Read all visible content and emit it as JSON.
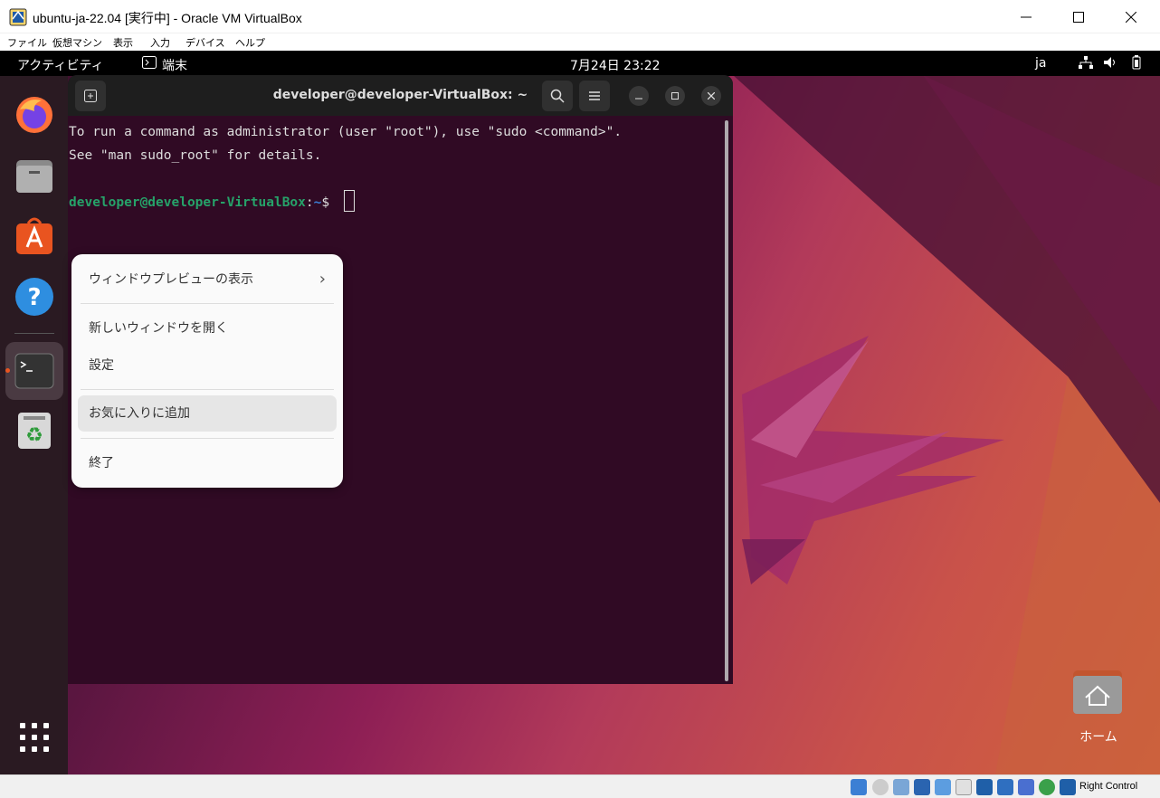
{
  "window": {
    "title": "ubuntu-ja-22.04 [実行中] - Oracle VM VirtualBox",
    "minimize_glyph": "—",
    "maximize_glyph": "☐",
    "close_glyph": "✕"
  },
  "menubar": {
    "items": [
      "ファイル",
      "仮想マシン",
      "表示",
      "入力",
      "デバイス",
      "ヘルプ"
    ]
  },
  "gnome_topbar": {
    "activities": "アクティビティ",
    "app_name": "端末",
    "clock": "7月24日  23:22",
    "input_method": "ja"
  },
  "terminal": {
    "title": "developer@developer-VirtualBox: ~",
    "lines": [
      "To run a command as administrator (user \"root\"), use \"sudo <command>\".",
      "See \"man sudo_root\" for details."
    ],
    "prompt_user": "developer@developer-VirtualBox",
    "prompt_sep": ":",
    "prompt_path": "~",
    "prompt_symbol": "$"
  },
  "context_menu": {
    "items": [
      "ウィンドウプレビューの表示",
      "新しいウィンドウを開く",
      "設定",
      "お気に入りに追加",
      "終了"
    ],
    "submenu_arrow": "›"
  },
  "desktop": {
    "home_label": "ホーム"
  },
  "statusbar": {
    "host_key": "Right Control"
  },
  "colors": {
    "terminal_bg": "#300a24",
    "prompt_green": "#26a269",
    "prompt_blue": "#12488b",
    "accent_orange": "#e95420"
  }
}
